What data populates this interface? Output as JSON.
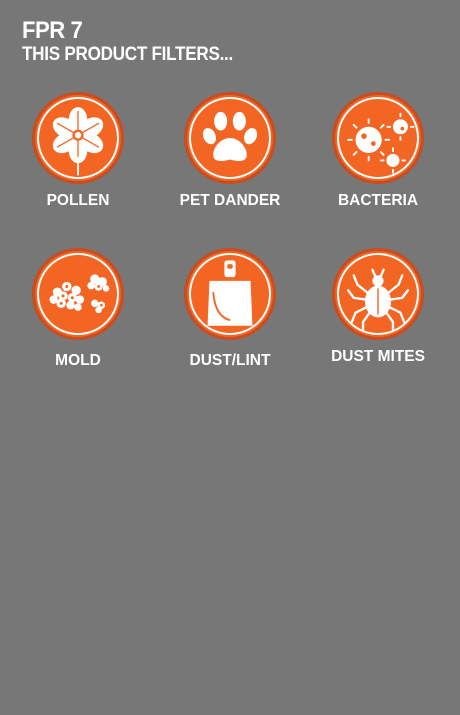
{
  "header": {
    "title": "FPR 7",
    "subtitle": "THIS PRODUCT FILTERS..."
  },
  "filters": [
    {
      "label": "POLLEN",
      "icon": "pollen-flower-icon"
    },
    {
      "label": "PET DANDER",
      "icon": "paw-print-icon"
    },
    {
      "label": "BACTERIA",
      "icon": "bacteria-icon"
    },
    {
      "label": "MOLD",
      "icon": "mold-spores-icon"
    },
    {
      "label": "DUST/LINT",
      "icon": "dustpan-icon"
    },
    {
      "label": "DUST MITES",
      "icon": "dust-mite-icon"
    }
  ],
  "colors": {
    "background": "#767776",
    "badge_fill": "#f26522",
    "badge_ring": "#c94d1e",
    "text": "#ffffff"
  }
}
